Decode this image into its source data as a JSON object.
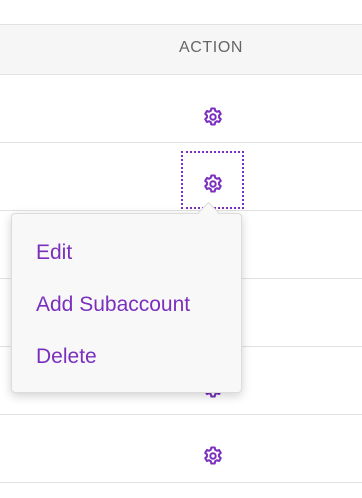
{
  "table": {
    "column_header": "ACTION"
  },
  "row_action": {
    "icon": "gear-icon",
    "color": "#7b2fbe"
  },
  "context_menu": {
    "items": [
      {
        "label": "Edit"
      },
      {
        "label": "Add Subaccount"
      },
      {
        "label": "Delete"
      }
    ]
  },
  "colors": {
    "accent": "#7b2fbe",
    "header_background": "#f6f6f6",
    "header_text": "#666666",
    "border": "#e2e2e2"
  }
}
